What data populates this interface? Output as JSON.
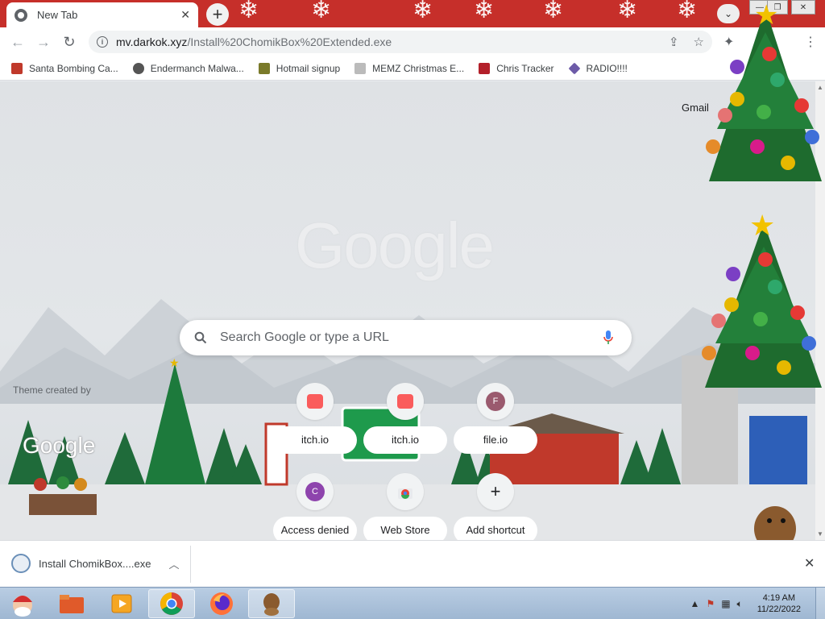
{
  "browser": {
    "tab": {
      "title": "New Tab"
    },
    "address": {
      "host": "mv.darkok.xyz",
      "path": "/Install%20ChomikBox%20Extended.exe"
    },
    "bookmarks": [
      {
        "label": "Santa Bombing Ca...",
        "icon": "santa-icon"
      },
      {
        "label": "Endermanch Malwa...",
        "icon": "raccoon-icon"
      },
      {
        "label": "Hotmail signup",
        "icon": "figure-icon"
      },
      {
        "label": "MEMZ Christmas E...",
        "icon": "memz-icon"
      },
      {
        "label": "Chris Tracker",
        "icon": "gift-icon"
      },
      {
        "label": "RADIO!!!!",
        "icon": "diamond-icon"
      }
    ]
  },
  "ntp": {
    "gmail_label": "Gmail",
    "logo_text": "Google",
    "search_placeholder": "Search Google or type a URL",
    "theme_credit": "Theme created by",
    "shortcuts": [
      {
        "label": "itch.io",
        "icon": "itch-icon"
      },
      {
        "label": "itch.io",
        "icon": "itch-icon"
      },
      {
        "label": "file.io",
        "icon": "letter-F",
        "letter": "F",
        "color": "#9a5a6e"
      },
      {
        "label": "Access denied",
        "icon": "letter-C",
        "letter": "C",
        "color": "#8e44ad"
      },
      {
        "label": "Web Store",
        "icon": "webstore-icon"
      },
      {
        "label": "Add shortcut",
        "icon": "plus-icon"
      }
    ]
  },
  "download": {
    "filename": "Install ChomikBox....exe"
  },
  "taskbar": {
    "time": "4:19 AM",
    "date": "11/22/2022"
  },
  "colors": {
    "tabstrip": "#c62f2a",
    "accent": "#1a73e8"
  }
}
